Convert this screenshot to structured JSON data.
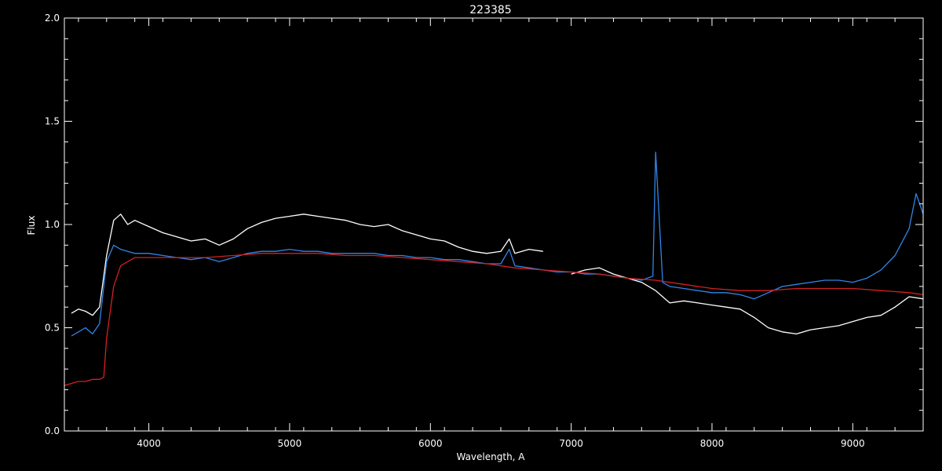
{
  "chart_data": {
    "type": "line",
    "title": "223385",
    "xlabel": "Wavelength, A",
    "ylabel": "Flux",
    "xlim": [
      3400,
      9500
    ],
    "ylim": [
      0.0,
      2.0
    ],
    "xticks": [
      4000,
      5000,
      6000,
      7000,
      8000,
      9000
    ],
    "xtick_labels": [
      "4000",
      "5000",
      "6000",
      "7000",
      "8000",
      "9000"
    ],
    "yticks": [
      0.0,
      0.5,
      1.0,
      1.5,
      2.0
    ],
    "ytick_labels": [
      "0.0",
      "0.5",
      "1.0",
      "1.5",
      "2.0"
    ],
    "grid": false,
    "background": "#000000",
    "series": [
      {
        "color": "#ffffff",
        "x": [
          3450,
          3500,
          3550,
          3600,
          3650,
          3700,
          3750,
          3800,
          3850,
          3900,
          4000,
          4100,
          4200,
          4300,
          4400,
          4500,
          4600,
          4700,
          4800,
          4900,
          5000,
          5100,
          5200,
          5300,
          5400,
          5500,
          5600,
          5700,
          5800,
          5900,
          6000,
          6100,
          6200,
          6300,
          6400,
          6500,
          6560,
          6600,
          6700,
          6800
        ],
        "y": [
          0.57,
          0.59,
          0.58,
          0.56,
          0.6,
          0.85,
          1.02,
          1.05,
          1.0,
          1.02,
          0.99,
          0.96,
          0.94,
          0.92,
          0.93,
          0.9,
          0.93,
          0.98,
          1.01,
          1.03,
          1.04,
          1.05,
          1.04,
          1.03,
          1.02,
          1.0,
          0.99,
          1.0,
          0.97,
          0.95,
          0.93,
          0.92,
          0.89,
          0.87,
          0.86,
          0.87,
          0.93,
          0.86,
          0.88,
          0.87
        ]
      },
      {
        "color": "#ffffff",
        "x": [
          7000,
          7100,
          7200,
          7300,
          7400,
          7500,
          7600,
          7700,
          7800,
          7900,
          8000,
          8100,
          8200,
          8300,
          8400,
          8500,
          8600,
          8700,
          8800,
          8900,
          9000,
          9100,
          9200,
          9300,
          9400,
          9500
        ],
        "y": [
          0.76,
          0.78,
          0.79,
          0.76,
          0.74,
          0.72,
          0.68,
          0.62,
          0.63,
          0.62,
          0.61,
          0.6,
          0.59,
          0.55,
          0.5,
          0.48,
          0.47,
          0.49,
          0.5,
          0.51,
          0.53,
          0.55,
          0.56,
          0.6,
          0.65,
          0.64
        ]
      },
      {
        "color": "#2f86e8",
        "x": [
          3450,
          3500,
          3550,
          3600,
          3650,
          3700,
          3750,
          3800,
          3850,
          3900,
          4000,
          4100,
          4200,
          4300,
          4400,
          4500,
          4600,
          4700,
          4800,
          4900,
          5000,
          5100,
          5200,
          5300,
          5400,
          5500,
          5600,
          5700,
          5800,
          5900,
          6000,
          6100,
          6200,
          6300,
          6400,
          6500,
          6560,
          6600,
          6700,
          6800,
          6900,
          7000,
          7100,
          7200,
          7300,
          7400,
          7500,
          7580,
          7600,
          7650,
          7700,
          7800,
          7900,
          8000,
          8100,
          8200,
          8300,
          8400,
          8500,
          8600,
          8700,
          8800,
          8900,
          9000,
          9100,
          9200,
          9300,
          9400,
          9450,
          9500
        ],
        "y": [
          0.46,
          0.48,
          0.5,
          0.47,
          0.52,
          0.82,
          0.9,
          0.88,
          0.87,
          0.86,
          0.86,
          0.85,
          0.84,
          0.83,
          0.84,
          0.82,
          0.84,
          0.86,
          0.87,
          0.87,
          0.88,
          0.87,
          0.87,
          0.86,
          0.86,
          0.86,
          0.86,
          0.85,
          0.85,
          0.84,
          0.84,
          0.83,
          0.83,
          0.82,
          0.81,
          0.81,
          0.88,
          0.8,
          0.79,
          0.78,
          0.77,
          0.77,
          0.76,
          0.76,
          0.75,
          0.74,
          0.73,
          0.75,
          1.35,
          0.72,
          0.7,
          0.69,
          0.68,
          0.67,
          0.67,
          0.66,
          0.64,
          0.67,
          0.7,
          0.71,
          0.72,
          0.73,
          0.73,
          0.72,
          0.74,
          0.78,
          0.85,
          0.98,
          1.15,
          1.05
        ]
      },
      {
        "color": "#d42020",
        "x": [
          3400,
          3450,
          3500,
          3550,
          3600,
          3650,
          3680,
          3700,
          3750,
          3800,
          3900,
          4000,
          4200,
          4400,
          4600,
          4800,
          5000,
          5200,
          5400,
          5600,
          5800,
          6000,
          6200,
          6400,
          6600,
          6800,
          7000,
          7200,
          7400,
          7600,
          7800,
          8000,
          8200,
          8400,
          8600,
          8800,
          9000,
          9200,
          9400,
          9500
        ],
        "y": [
          0.22,
          0.23,
          0.24,
          0.24,
          0.25,
          0.25,
          0.26,
          0.45,
          0.7,
          0.8,
          0.84,
          0.84,
          0.84,
          0.84,
          0.85,
          0.86,
          0.86,
          0.86,
          0.85,
          0.85,
          0.84,
          0.83,
          0.82,
          0.81,
          0.79,
          0.78,
          0.77,
          0.76,
          0.74,
          0.73,
          0.71,
          0.69,
          0.68,
          0.68,
          0.69,
          0.69,
          0.69,
          0.68,
          0.67,
          0.66
        ]
      }
    ]
  }
}
